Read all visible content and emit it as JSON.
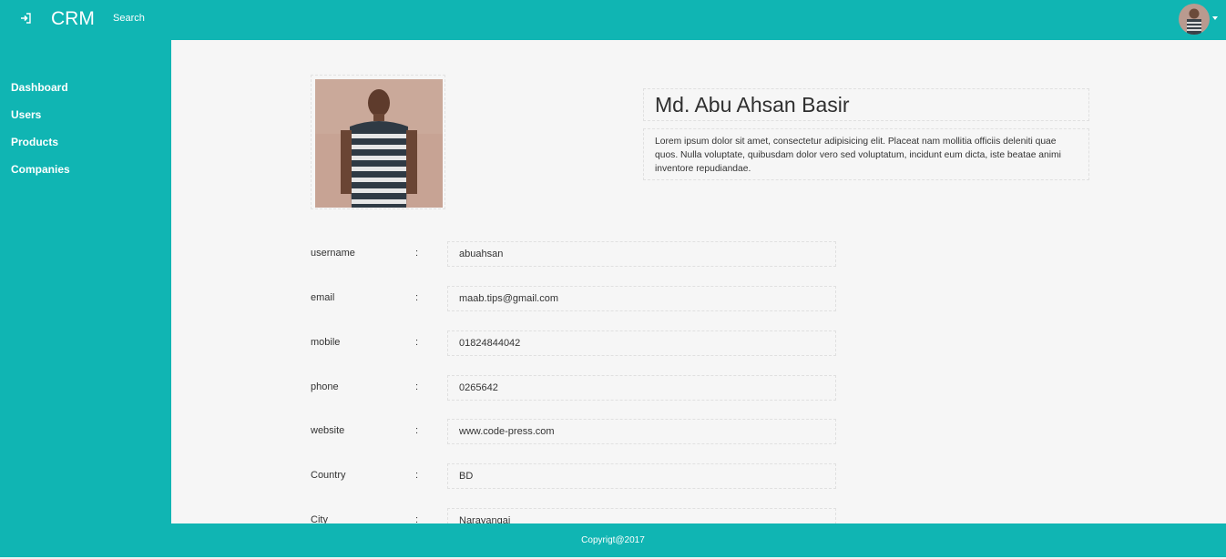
{
  "header": {
    "brand": "CRM",
    "search_label": "Search"
  },
  "sidebar": {
    "items": [
      {
        "label": "Dashboard"
      },
      {
        "label": "Users"
      },
      {
        "label": "Products"
      },
      {
        "label": "Companies"
      }
    ]
  },
  "profile": {
    "name": "Md. Abu Ahsan Basir",
    "bio": "Lorem ipsum dolor sit amet, consectetur adipisicing elit. Placeat nam mollitia officiis deleniti quae quos. Nulla voluptate, quibusdam dolor vero sed voluptatum, incidunt eum dicta, iste beatae animi inventore repudiandae.",
    "fields": [
      {
        "label": "username",
        "sep": ":",
        "value": "abuahsan"
      },
      {
        "label": "email",
        "sep": ":",
        "value": "maab.tips@gmail.com"
      },
      {
        "label": "mobile",
        "sep": ":",
        "value": "01824844042"
      },
      {
        "label": "phone",
        "sep": ":",
        "value": "0265642"
      },
      {
        "label": "website",
        "sep": ":",
        "value": "www.code-press.com"
      },
      {
        "label": "Country",
        "sep": ":",
        "value": "BD"
      },
      {
        "label": "City",
        "sep": ":",
        "value": "Narayangaj"
      }
    ]
  },
  "footer": {
    "text": "Copyrigt@2017"
  },
  "colors": {
    "accent": "#10b5b3",
    "content_bg": "#f6f6f6"
  },
  "icons": {
    "menu_toggle": "sign-in-icon",
    "user_menu": "chevron-down-icon"
  }
}
